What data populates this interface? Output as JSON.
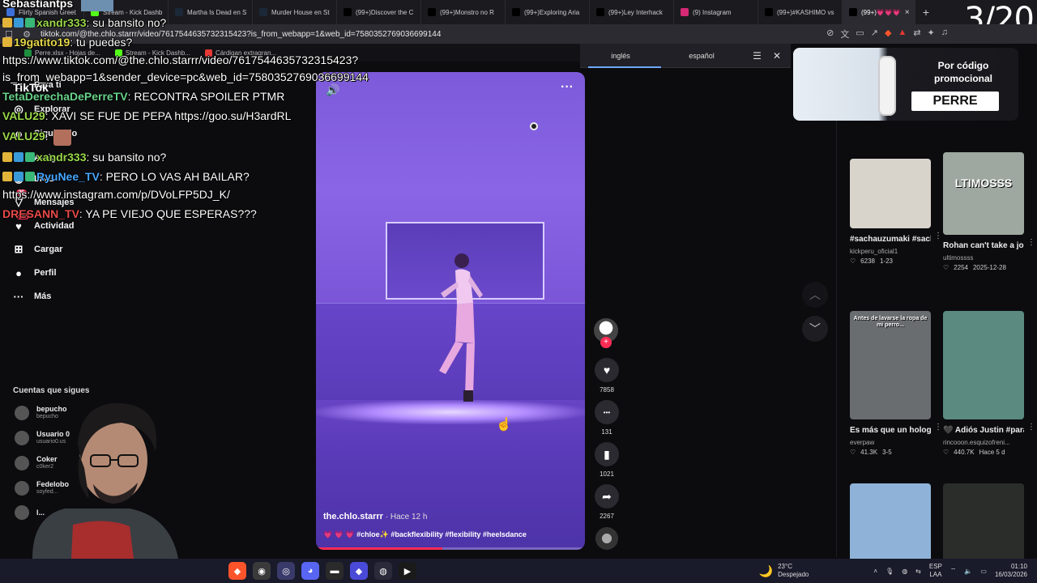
{
  "browser": {
    "tabs": [
      {
        "title": "Flirty Spanish Greet",
        "icon": "document-icon",
        "color": "#3e6fd8"
      },
      {
        "title": "Stream - Kick Dashb",
        "icon": "kick-icon",
        "color": "#53fc18"
      },
      {
        "title": "Martha Is Dead en S",
        "icon": "steam-icon",
        "color": "#1b2838"
      },
      {
        "title": "Murder House en St",
        "icon": "steam-icon",
        "color": "#1b2838"
      },
      {
        "title": "(99+)Discover the C",
        "icon": "tiktok-icon",
        "color": "#000000"
      },
      {
        "title": "(99+)Monstro no R",
        "icon": "tiktok-icon",
        "color": "#000000"
      },
      {
        "title": "(99+)Exploring Aria",
        "icon": "tiktok-icon",
        "color": "#000000"
      },
      {
        "title": "(99+)Ley Interhack",
        "icon": "tiktok-icon",
        "color": "#000000"
      },
      {
        "title": "(9) Instagram",
        "icon": "instagram-icon",
        "color": "#d62976"
      },
      {
        "title": "(99+)#KASHIMO vs",
        "icon": "tiktok-icon",
        "color": "#000000"
      },
      {
        "title": "(99+)💗💗💗",
        "icon": "tiktok-icon",
        "color": "#000000",
        "active": true
      }
    ],
    "new_tab": "+",
    "url": "tiktok.com/@the.chlo.starrr/video/7617544635732315423?is_from_webapp=1&web_id=7580352769036699144",
    "bookmarks": [
      {
        "label": "Perre.xlsx - Hojas de...",
        "color": "#1e8e3e"
      },
      {
        "label": "Stream - Kick Dashb...",
        "color": "#53fc18"
      },
      {
        "label": "Cárdigan extragran...",
        "color": "#e53935"
      }
    ],
    "translate": {
      "lang_from": "inglés",
      "lang_to": "español"
    }
  },
  "overlay_counter": "3/20",
  "chat": [
    {
      "user": "Sebastiantps",
      "text": "",
      "color": "#ffffff"
    },
    {
      "user": "xandr333",
      "text": ": su bansito no?",
      "color": "#9bd84a",
      "badges": 3
    },
    {
      "user": "19gatito19",
      "text": ": tu puedes?",
      "color": "#e6d84a",
      "badges": 1
    },
    {
      "user": "",
      "text": "https://www.tiktok.com/@the.chlo.starrr/video/7617544635732315423?",
      "color": "#ffffff"
    },
    {
      "user": "",
      "text": "is_from_webapp=1&sender_device=pc&web_id=7580352769036699144",
      "color": "#ffffff"
    },
    {
      "user": "TetaDerechaDePerreTV",
      "text": ": RECONTRA SPOILER PTMR",
      "color": "#68d38b"
    },
    {
      "user": "VALU29",
      "text": ": XAVI SE FUE DE PEPA https://goo.su/H3ardRL",
      "color": "#9bd84a"
    },
    {
      "user": "VALU29",
      "text": ":",
      "color": "#9bd84a"
    },
    {
      "user": "xandr333",
      "text": ": su bansito no?",
      "color": "#9bd84a",
      "badges": 3
    },
    {
      "user": "RyuNee_TV",
      "text": ": PERO LO VAS AH BAILAR?",
      "color": "#46a7ff",
      "badges": 3
    },
    {
      "user": "",
      "text": "https://www.instagram.com/p/DVoLFP5DJ_K/",
      "color": "#ffffff"
    },
    {
      "user": "DRESANN_TV",
      "text": ": YA PE VIEJO QUE ESPERAS???",
      "color": "#e84a4a"
    }
  ],
  "tiktok_logo": "TikTok",
  "nav": [
    {
      "label": "Para ti",
      "icon": "home-icon"
    },
    {
      "label": "Explorar",
      "icon": "compass-icon"
    },
    {
      "label": "Siguiendo",
      "icon": "following-icon"
    },
    {
      "label": "Amigos",
      "icon": "friends-icon"
    },
    {
      "label": "LIVE",
      "icon": "live-icon"
    },
    {
      "label": "Mensajes",
      "icon": "messages-icon",
      "badge": "99"
    },
    {
      "label": "Actividad",
      "icon": "activity-icon",
      "badge": "99+"
    },
    {
      "label": "Cargar",
      "icon": "upload-icon"
    },
    {
      "label": "Perfil",
      "icon": "profile-icon"
    },
    {
      "label": "Más",
      "icon": "more-icon"
    }
  ],
  "following": {
    "title": "Cuentas que sigues",
    "accounts": [
      {
        "name": "bepucho",
        "user": "bepucho"
      },
      {
        "name": "Usuario 0",
        "user": "usuario0.us"
      },
      {
        "name": "Coker",
        "user": "c0ker2"
      },
      {
        "name": "Fedelobo",
        "user": "soyfed..."
      },
      {
        "name": "l...",
        "user": ""
      }
    ]
  },
  "video": {
    "author": "the.chlo.starrr",
    "time": " · Hace 12 h",
    "caption": "💗 💗 💗 #chloe✨ #backflexibility #flexibility #heelsdance",
    "progress": 0.47
  },
  "actions": [
    {
      "name": "like",
      "icon": "heart-icon",
      "glyph": "♥",
      "count": "7858"
    },
    {
      "name": "comment",
      "icon": "comment-icon",
      "glyph": "•••",
      "count": "131"
    },
    {
      "name": "save",
      "icon": "bookmark-icon",
      "glyph": "▮",
      "count": "1021"
    },
    {
      "name": "share",
      "icon": "share-icon",
      "glyph": "➦",
      "count": "2267"
    }
  ],
  "promo": {
    "text": "Por código promocional",
    "code": "PERRE"
  },
  "recommended": [
    {
      "title": "#sachauzumaki #sachauzumakicl...",
      "user": "kickperu_oficial1",
      "likes": "6238",
      "date": "1-23",
      "thumb": "#d8d4cc"
    },
    {
      "title": "Rohan can't take a joke #jojo #edit...",
      "user": "ultimossss",
      "likes": "2254",
      "date": "2025-12-28",
      "thumb": "#9fa8a0",
      "thumb_text": "LTIMOSSS"
    },
    {
      "title": "Es más que un holograma, es su...",
      "user": "everpaw",
      "likes": "41.3K",
      "date": "3-5",
      "thumb": "#6a6d70",
      "thumb_text": "Antes de lavarse la ropa de mi perro..."
    },
    {
      "title": "🖤 Adiós Justin #paratiiiiiiiiiiiiiiiiii...",
      "user": "rincooon.esquizofreni...",
      "likes": "440.7K",
      "date": "Hace 5 d",
      "thumb": "#5a8a80"
    },
    {
      "title": "",
      "user": "",
      "likes": "",
      "date": "",
      "thumb": "#8fb3d8"
    },
    {
      "title": "",
      "user": "",
      "likes": "",
      "date": "",
      "thumb": "#2a2d2a"
    }
  ],
  "taskbar": {
    "apps": [
      {
        "icon": "brave-icon",
        "color": "#fb542b",
        "glyph": "◆"
      },
      {
        "icon": "app-icon",
        "color": "#3a3a3a",
        "glyph": "◉"
      },
      {
        "icon": "obs-icon",
        "color": "#3a3a6a",
        "glyph": "◎"
      },
      {
        "icon": "discord-icon",
        "color": "#5865f2",
        "glyph": "◕"
      },
      {
        "icon": "terminal-icon",
        "color": "#2a2a2a",
        "glyph": "▬"
      },
      {
        "icon": "app-icon",
        "color": "#4a4ad8",
        "glyph": "◆"
      },
      {
        "icon": "steam-icon",
        "color": "#2a2a3a",
        "glyph": "◍"
      },
      {
        "icon": "kick-icon",
        "color": "#1a1a1a",
        "glyph": "▶"
      }
    ],
    "weather_temp": "23°C",
    "weather_desc": "Despejado",
    "lang": "ESP",
    "lang_sub": "LAA",
    "time": "01:10",
    "date": "16/03/2026"
  },
  "colors": {
    "accent": "#fe2c55"
  }
}
